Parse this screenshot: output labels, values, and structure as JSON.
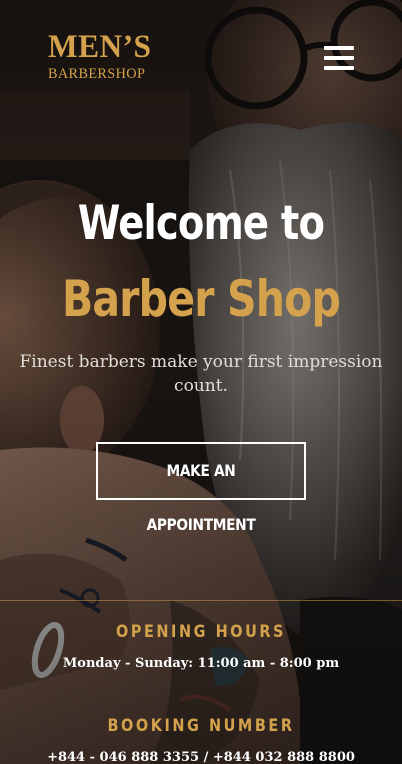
{
  "header": {
    "logo_main": "MEN’S",
    "logo_sub": "BARBERSHOP",
    "menu_icon": "hamburger-menu-icon"
  },
  "hero": {
    "title_line_1": "Welcome to",
    "title_line_2": "Barber Shop",
    "tagline": "Finest barbers make your first impression count.",
    "cta_label": "MAKE AN APPOINTMENT"
  },
  "info": {
    "hours_heading": "OPENING HOURS",
    "hours_value": "Monday - Sunday: 11:00 am - 8:00 pm",
    "booking_heading": "BOOKING NUMBER",
    "booking_value": "+844 - 046 888 3355 / +844 032 888 8800"
  },
  "colors": {
    "accent": "#d4a24c",
    "text_light": "#ffffff",
    "background": "#161311"
  }
}
